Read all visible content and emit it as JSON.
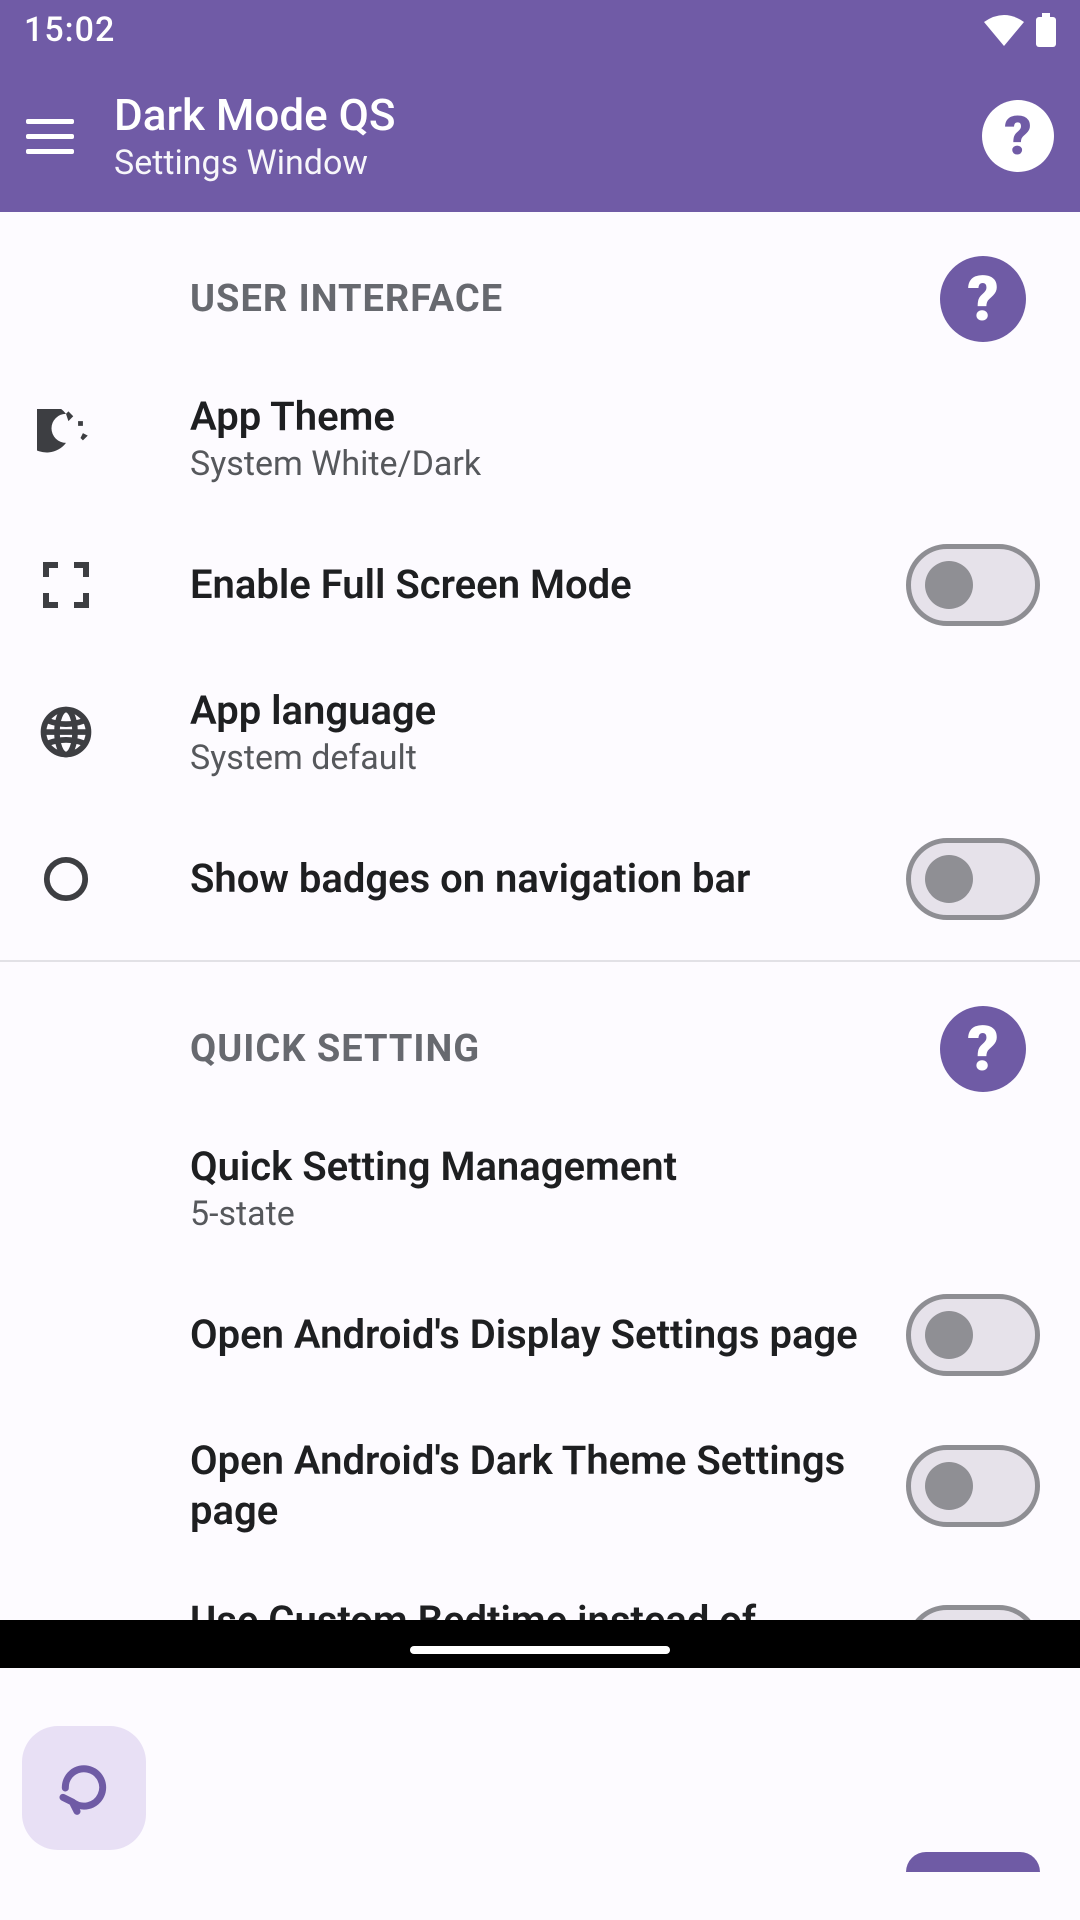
{
  "status": {
    "time": "15:02"
  },
  "header": {
    "title": "Dark Mode QS",
    "subtitle": "Settings Window"
  },
  "sections": {
    "user_interface": {
      "title": "USER INTERFACE",
      "items": {
        "app_theme": {
          "title": "App Theme",
          "subtitle": "System White/Dark"
        },
        "full_screen": {
          "title": "Enable Full Screen Mode"
        },
        "language": {
          "title": "App language",
          "subtitle": "System default"
        },
        "badges": {
          "title": "Show badges on navigation bar"
        }
      }
    },
    "quick_setting": {
      "title": "QUICK SETTING",
      "items": {
        "management": {
          "title": "Quick Setting Management",
          "subtitle": "5-state"
        },
        "display_settings": {
          "title": "Open Android's Display Settings page"
        },
        "dark_theme_settings": {
          "title": "Open Android's Dark Theme Settings page"
        },
        "bedtime": {
          "title": "Use Custom Bedtime instead of Custom Schedule"
        }
      }
    }
  }
}
